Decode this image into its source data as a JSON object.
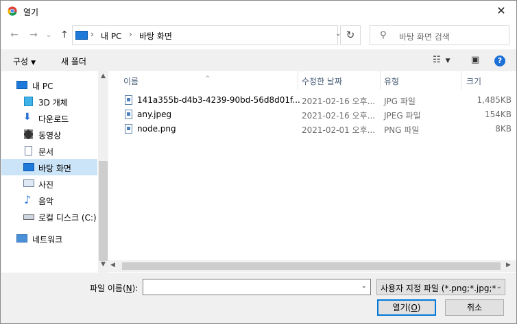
{
  "titlebar": {
    "title": "열기",
    "close_glyph": "✕",
    "icon": "chrome-icon"
  },
  "nav": {
    "back_glyph": "←",
    "forward_glyph": "→",
    "recent_glyph": "⌄",
    "up_glyph": "↑",
    "breadcrumbs": [
      "내 PC",
      "바탕 화면"
    ],
    "refresh_glyph": "↻",
    "search_placeholder": "바탕 화면 검색"
  },
  "toolbar": {
    "organize": "구성",
    "new_folder": "새 폴더",
    "help": "?"
  },
  "sidebar": {
    "items": [
      {
        "label": "내 PC",
        "icon": "pc-icon"
      },
      {
        "label": "3D 개체",
        "icon": "3d-objects-icon"
      },
      {
        "label": "다운로드",
        "icon": "download-icon"
      },
      {
        "label": "동영상",
        "icon": "video-icon"
      },
      {
        "label": "문서",
        "icon": "document-icon"
      },
      {
        "label": "바탕 화면",
        "icon": "desktop-icon",
        "selected": true
      },
      {
        "label": "사진",
        "icon": "pictures-icon"
      },
      {
        "label": "음악",
        "icon": "music-icon"
      },
      {
        "label": "로컬 디스크 (C:)",
        "icon": "drive-icon"
      },
      {
        "label": "네트워크",
        "icon": "network-icon"
      }
    ]
  },
  "columns": {
    "name": "이름",
    "modified": "수정한 날짜",
    "type": "유형",
    "size": "크기"
  },
  "files": [
    {
      "name": "141a355b-d4b3-4239-90bd-56d8d01f...",
      "modified": "2021-02-16 오후...",
      "type": "JPG 파일",
      "size": "1,485KB"
    },
    {
      "name": "any.jpeg",
      "modified": "2021-02-16 오후...",
      "type": "JPEG 파일",
      "size": "154KB"
    },
    {
      "name": "node.png",
      "modified": "2021-02-01 오후...",
      "type": "PNG 파일",
      "size": "8KB"
    }
  ],
  "footer": {
    "filename_label_pre": "파일 이름(",
    "filename_label_key": "N",
    "filename_label_post": "):",
    "filename_value": "",
    "filetype": "사용자 지정 파일 (*.png;*.jpg;*",
    "open_pre": "열기(",
    "open_key": "O",
    "open_post": ")",
    "cancel": "취소"
  }
}
